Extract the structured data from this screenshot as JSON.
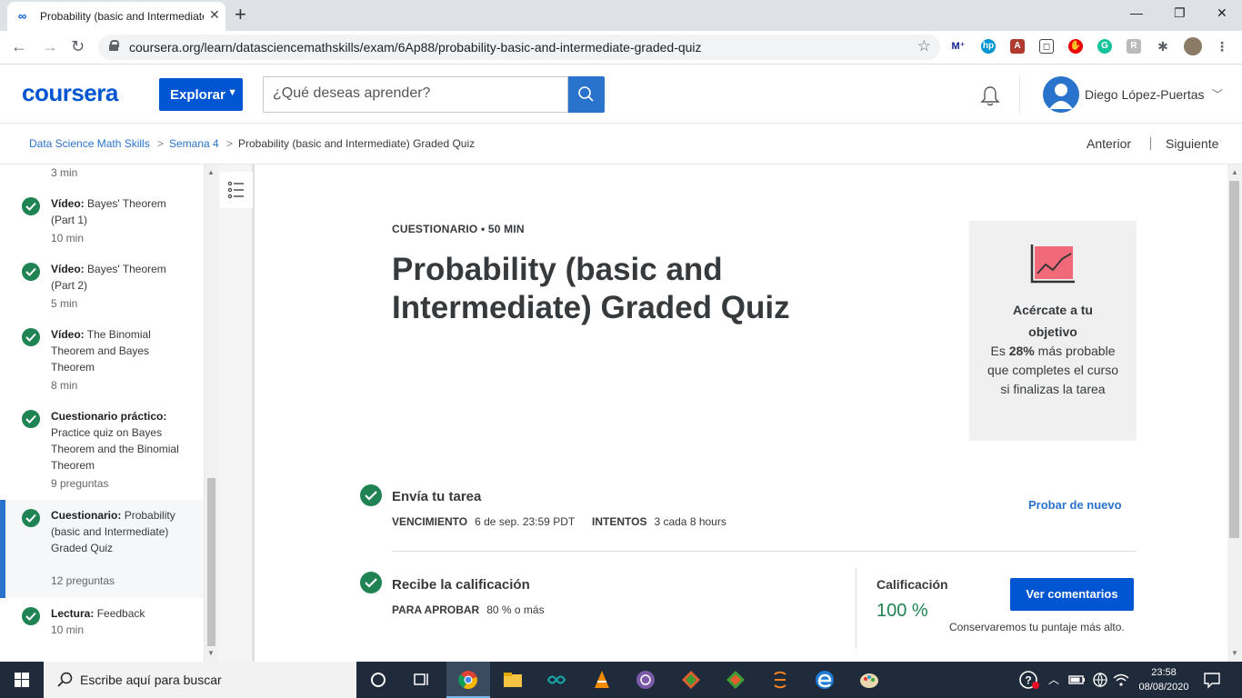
{
  "browser": {
    "tab_title": "Probability (basic and Intermediate",
    "new_tab": "+",
    "url": "coursera.org/learn/datasciencemathskills/exam/6Ap88/probability-basic-and-intermediate-graded-quiz",
    "window_controls": {
      "minimize": "—",
      "maximize": "❐",
      "close": "✕"
    }
  },
  "header": {
    "logo": "coursera",
    "explore_label": "Explorar",
    "search_placeholder": "¿Qué deseas aprender?",
    "user_name": "Diego López-Puertas"
  },
  "breadcrumb": {
    "items": [
      "Data Science Math Skills",
      "Semana 4",
      "Probability (basic and Intermediate) Graded Quiz"
    ],
    "separator": ">",
    "prev": "Anterior",
    "next": "Siguiente"
  },
  "sidebar": {
    "top_meta": "3 min",
    "items": [
      {
        "type": "Vídeo:",
        "name": "Bayes' Theorem (Part 1)",
        "meta": "10 min"
      },
      {
        "type": "Vídeo:",
        "name": "Bayes' Theorem (Part 2)",
        "meta": "5 min"
      },
      {
        "type": "Vídeo:",
        "name": "The Binomial Theorem and Bayes Theorem",
        "meta": "8 min"
      },
      {
        "type": "Cuestionario práctico:",
        "name": "Practice quiz on Bayes Theorem and the Binomial Theorem",
        "meta": "9 preguntas"
      },
      {
        "type": "Cuestionario:",
        "name": "Probability (basic and Intermediate) Graded Quiz",
        "meta": "12 preguntas"
      },
      {
        "type": "Lectura:",
        "name": "Feedback",
        "meta": "10 min"
      }
    ]
  },
  "quiz": {
    "label": "CUESTIONARIO • 50 MIN",
    "title": "Probability (basic and Intermediate) Graded Quiz"
  },
  "goal_card": {
    "title": "Acércate a tu objetivo",
    "desc_pre": "Es ",
    "desc_bold": "28%",
    "desc_post": " más probable que completes el curso si finalizas la tarea"
  },
  "submit": {
    "title": "Envía tu tarea",
    "due_label": "VENCIMIENTO",
    "due_value": "6 de sep. 23:59 PDT",
    "attempts_label": "INTENTOS",
    "attempts_value": "3 cada 8 hours",
    "retry": "Probar de nuevo"
  },
  "grade": {
    "title": "Recibe la calificación",
    "pass_label": "PARA APROBAR",
    "pass_value": "80 % o más",
    "grade_label": "Calificación",
    "grade_value": "100 %",
    "feedback_button": "Ver comentarios",
    "keep_note": "Conservaremos tu puntaje más alto."
  },
  "taskbar": {
    "search_placeholder": "Escribe aquí para buscar",
    "time": "23:58",
    "date": "08/08/2020"
  },
  "colors": {
    "brand": "#0056d2",
    "link": "#2a73cc",
    "success": "#1f8354",
    "goal_icon": "#f06a7a"
  }
}
